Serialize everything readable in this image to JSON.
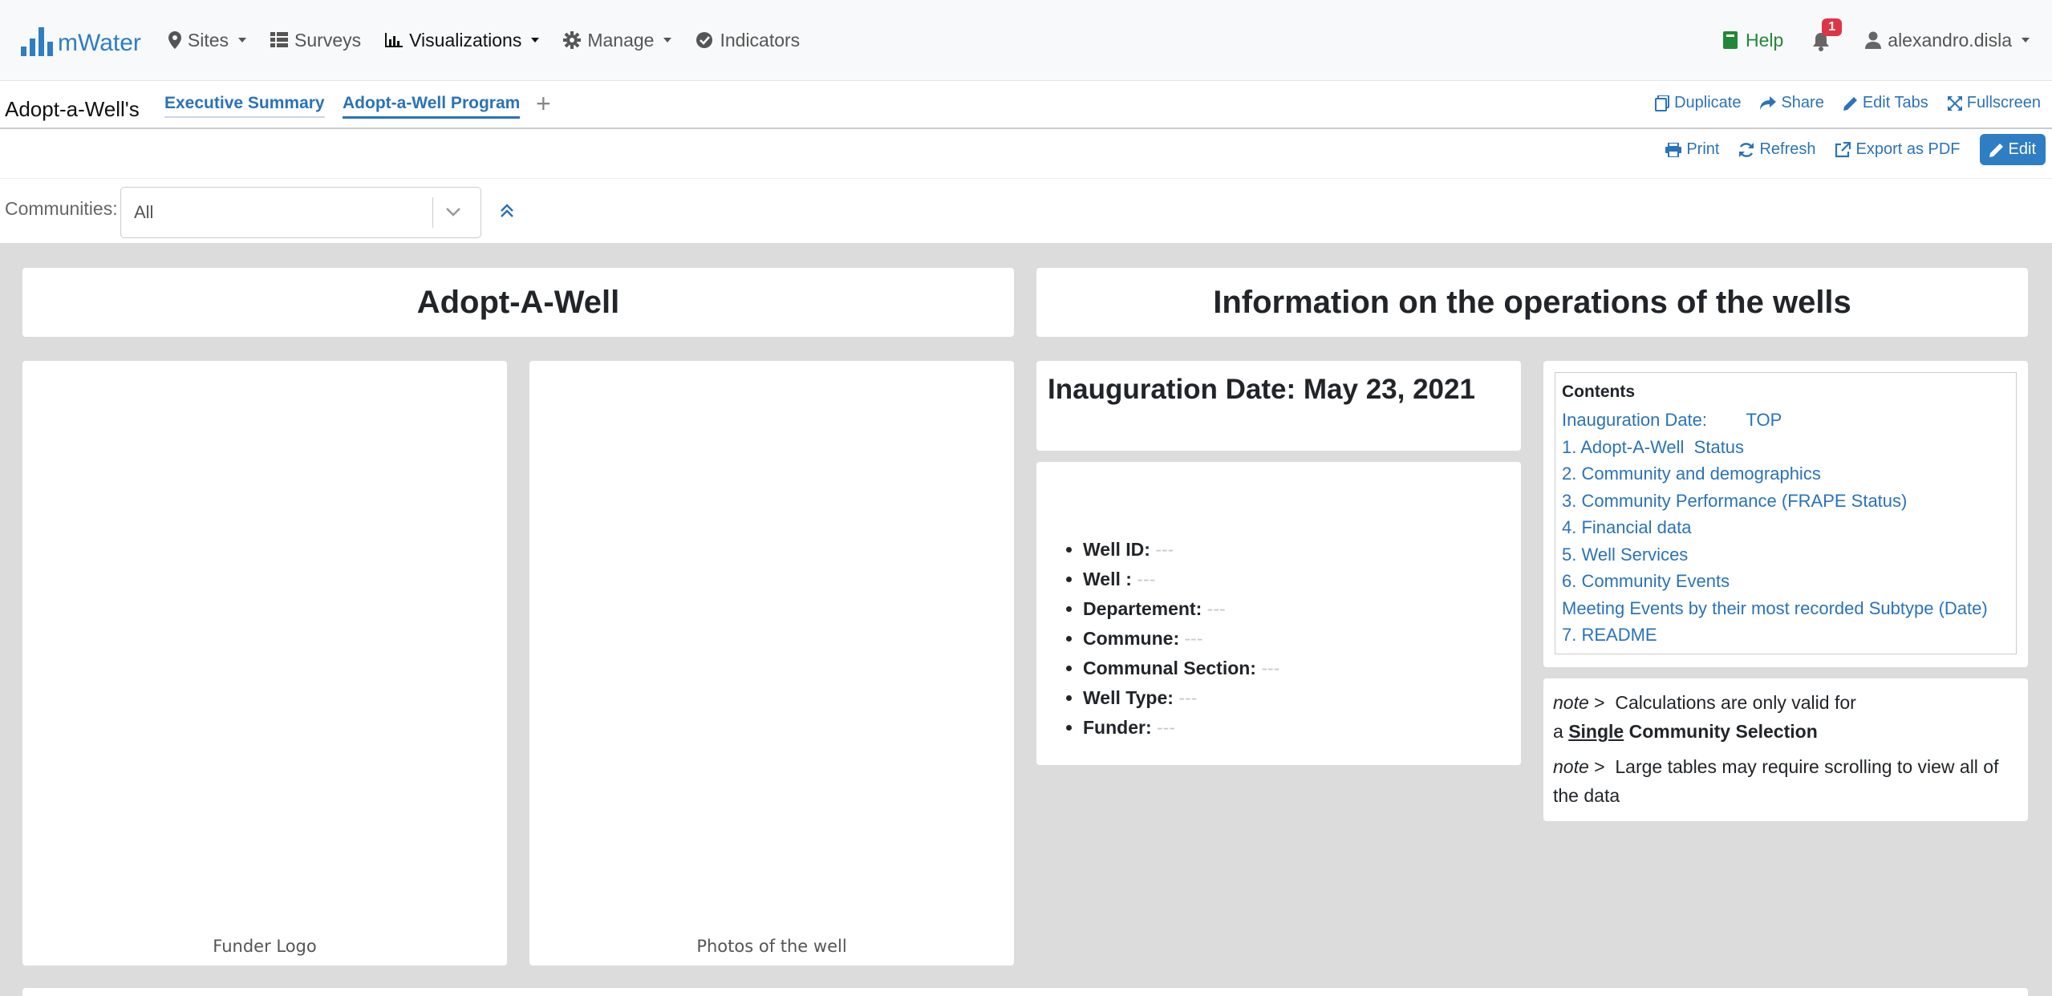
{
  "navbar": {
    "brand": "mWater",
    "items": [
      {
        "icon": "map-marker-icon",
        "label": "Sites",
        "dropdown": true
      },
      {
        "icon": "table-icon",
        "label": "Surveys",
        "dropdown": false
      },
      {
        "icon": "bar-chart-icon",
        "label": "Visualizations",
        "dropdown": true
      },
      {
        "icon": "gear-icon",
        "label": "Manage",
        "dropdown": true
      },
      {
        "icon": "check-circle-icon",
        "label": "Indicators",
        "dropdown": false
      }
    ],
    "help_label": "Help",
    "notification_count": "1",
    "username": "alexandro.disla",
    "colors": {
      "brand": "#2f7dc3",
      "help": "#218838",
      "badge": "#dc3545"
    }
  },
  "tabs": {
    "dashboard_title": "Adopt-a-Well's",
    "items": [
      "Executive Summary",
      "Adopt-a-Well Program"
    ],
    "add_label": "+",
    "actions": [
      "Duplicate",
      "Share",
      "Edit Tabs",
      "Fullscreen"
    ]
  },
  "actions": {
    "print": "Print",
    "refresh": "Refresh",
    "export": "Export as PDF",
    "edit": "Edit"
  },
  "filter": {
    "label": "Communities:",
    "value": "All"
  },
  "widgets": {
    "title_left": "Adopt-A-Well",
    "title_right": "Information on the operations of the wells",
    "funder_logo_caption": "Funder Logo",
    "photos_caption": "Photos of the well",
    "inauguration": "Inauguration Date: May 23, 2021",
    "well_info": [
      {
        "label": "Well ID:",
        "value": "---"
      },
      {
        "label": "Well :",
        "value": "---"
      },
      {
        "label": "Departement:",
        "value": "---"
      },
      {
        "label": "Commune:",
        "value": "---"
      },
      {
        "label": "Communal Section:",
        "value": "---"
      },
      {
        "label": "Well Type:",
        "value": "---"
      },
      {
        "label": "Funder:",
        "value": "---"
      }
    ],
    "contents": {
      "heading": "Contents",
      "links": [
        "Inauguration Date:        TOP",
        "1. Adopt-A-Well  Status",
        "2. Community and demographics",
        "3. Community Performance (FRAPE Status)",
        "4. Financial data",
        "5. Well Services",
        "6. Community Events",
        "Meeting Events by their most recorded Subtype (Date)",
        "7. README"
      ]
    },
    "notes": {
      "note_prefix": "note",
      "arrow": ">",
      "note1_text": "Calculations are only valid for",
      "note1_a": "a",
      "note1_single": "Single",
      "note1_rest": "Community Selection",
      "note2_text": "Large tables may require scrolling to view all of the data"
    }
  }
}
